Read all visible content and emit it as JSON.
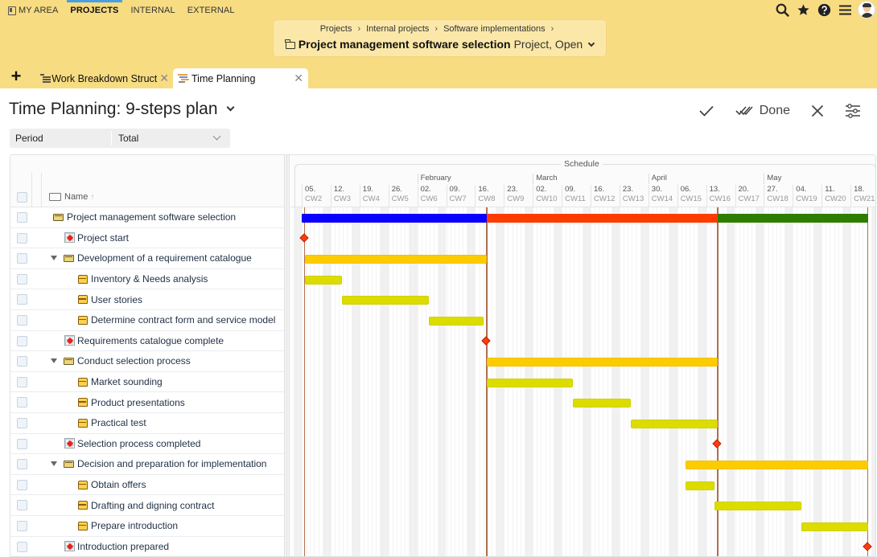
{
  "top_nav": {
    "items": [
      {
        "label": "MY AREA",
        "icon": "my-area-icon",
        "active": false
      },
      {
        "label": "PROJECTS",
        "active": true
      },
      {
        "label": "INTERNAL",
        "active": false
      },
      {
        "label": "EXTERNAL",
        "active": false
      }
    ],
    "right_icons": [
      "search-icon",
      "star-icon",
      "help-icon",
      "menu-icon",
      "user-avatar"
    ]
  },
  "breadcrumb": {
    "items": [
      "Projects",
      "Internal projects",
      "Software implementations"
    ],
    "separator": "›"
  },
  "project": {
    "name": "Project management software selection",
    "state": "Project, Open"
  },
  "tabs": [
    {
      "label": "Work Breakdown Struct",
      "icon": "wbs-icon",
      "active": false
    },
    {
      "label": "Time Planning",
      "icon": "time-planning-icon",
      "active": true
    }
  ],
  "page": {
    "title": "Time Planning: 9-steps plan",
    "actions": {
      "done_label": "Done"
    }
  },
  "filter": {
    "label": "Period",
    "value": "Total"
  },
  "table": {
    "name_header": "Name",
    "schedule_header": "Schedule",
    "months": [
      {
        "label": "February",
        "week_index": 4
      },
      {
        "label": "March",
        "week_index": 8
      },
      {
        "label": "April",
        "week_index": 12
      },
      {
        "label": "May",
        "week_index": 16
      }
    ],
    "weeks": [
      {
        "date": "05.",
        "cw": "CW2"
      },
      {
        "date": "12.",
        "cw": "CW3"
      },
      {
        "date": "19.",
        "cw": "CW4"
      },
      {
        "date": "26.",
        "cw": "CW5"
      },
      {
        "date": "02.",
        "cw": "CW6"
      },
      {
        "date": "09.",
        "cw": "CW7"
      },
      {
        "date": "16.",
        "cw": "CW8"
      },
      {
        "date": "23.",
        "cw": "CW9"
      },
      {
        "date": "02.",
        "cw": "CW10"
      },
      {
        "date": "09.",
        "cw": "CW11"
      },
      {
        "date": "16.",
        "cw": "CW12"
      },
      {
        "date": "23.",
        "cw": "CW13"
      },
      {
        "date": "30.",
        "cw": "CW14"
      },
      {
        "date": "06.",
        "cw": "CW15"
      },
      {
        "date": "13.",
        "cw": "CW16"
      },
      {
        "date": "20.",
        "cw": "CW17"
      },
      {
        "date": "27.",
        "cw": "CW18"
      },
      {
        "date": "04.",
        "cw": "CW19"
      },
      {
        "date": "11.",
        "cw": "CW20"
      },
      {
        "date": "18.",
        "cw": "CW21"
      }
    ],
    "rows": [
      {
        "name": "Project management software selection",
        "type": "project",
        "level": 0,
        "start_week": 0.0,
        "end_week": 19.6,
        "segments": [
          {
            "from": 0.0,
            "to": 6.4,
            "color": "#0a00ff"
          },
          {
            "from": 6.4,
            "to": 14.4,
            "color": "#ff3c00"
          },
          {
            "from": 14.4,
            "to": 19.6,
            "color": "#2e7d00"
          }
        ]
      },
      {
        "name": "Project start",
        "type": "milestone",
        "level": 1,
        "at_week": 0.1
      },
      {
        "name": "Development of a requirement catalogue",
        "type": "phase",
        "level": 1,
        "expanded": true,
        "start_week": 0.1,
        "end_week": 6.4
      },
      {
        "name": "Inventory & Needs analysis",
        "type": "task",
        "level": 2,
        "start_week": 0.1,
        "end_week": 1.4
      },
      {
        "name": "User stories",
        "type": "task",
        "level": 2,
        "start_week": 1.4,
        "end_week": 4.4
      },
      {
        "name": "Determine contract form and service model",
        "type": "task",
        "level": 2,
        "start_week": 4.4,
        "end_week": 6.3
      },
      {
        "name": "Requirements catalogue complete",
        "type": "milestone",
        "level": 1,
        "at_week": 6.4
      },
      {
        "name": "Conduct selection process",
        "type": "phase",
        "level": 1,
        "expanded": true,
        "start_week": 6.4,
        "end_week": 14.4
      },
      {
        "name": "Market sounding",
        "type": "task",
        "level": 2,
        "start_week": 6.4,
        "end_week": 9.4
      },
      {
        "name": "Product presentations",
        "type": "task",
        "level": 2,
        "start_week": 9.4,
        "end_week": 11.4
      },
      {
        "name": "Practical test",
        "type": "task",
        "level": 2,
        "start_week": 11.4,
        "end_week": 14.4
      },
      {
        "name": "Selection process completed",
        "type": "milestone",
        "level": 1,
        "at_week": 14.4
      },
      {
        "name": "Decision and preparation for implementation",
        "type": "phase",
        "level": 1,
        "expanded": true,
        "start_week": 13.3,
        "end_week": 19.6
      },
      {
        "name": "Obtain offers",
        "type": "task",
        "level": 2,
        "start_week": 13.3,
        "end_week": 14.3
      },
      {
        "name": "Drafting and digning contract",
        "type": "task",
        "level": 2,
        "start_week": 14.3,
        "end_week": 17.3
      },
      {
        "name": "Prepare introduction",
        "type": "task",
        "level": 2,
        "start_week": 17.3,
        "end_week": 19.6
      },
      {
        "name": "Introduction prepared",
        "type": "milestone",
        "level": 1,
        "at_week": 19.6
      }
    ]
  },
  "colors": {
    "header_bg": "#f8dc82",
    "crumb_card_bg": "#fbe8a8",
    "phase_bar": "#fccc00",
    "task_bar": "#dcdc00",
    "milestone": "#ff3c0f",
    "milestone_line": "#b07050"
  }
}
